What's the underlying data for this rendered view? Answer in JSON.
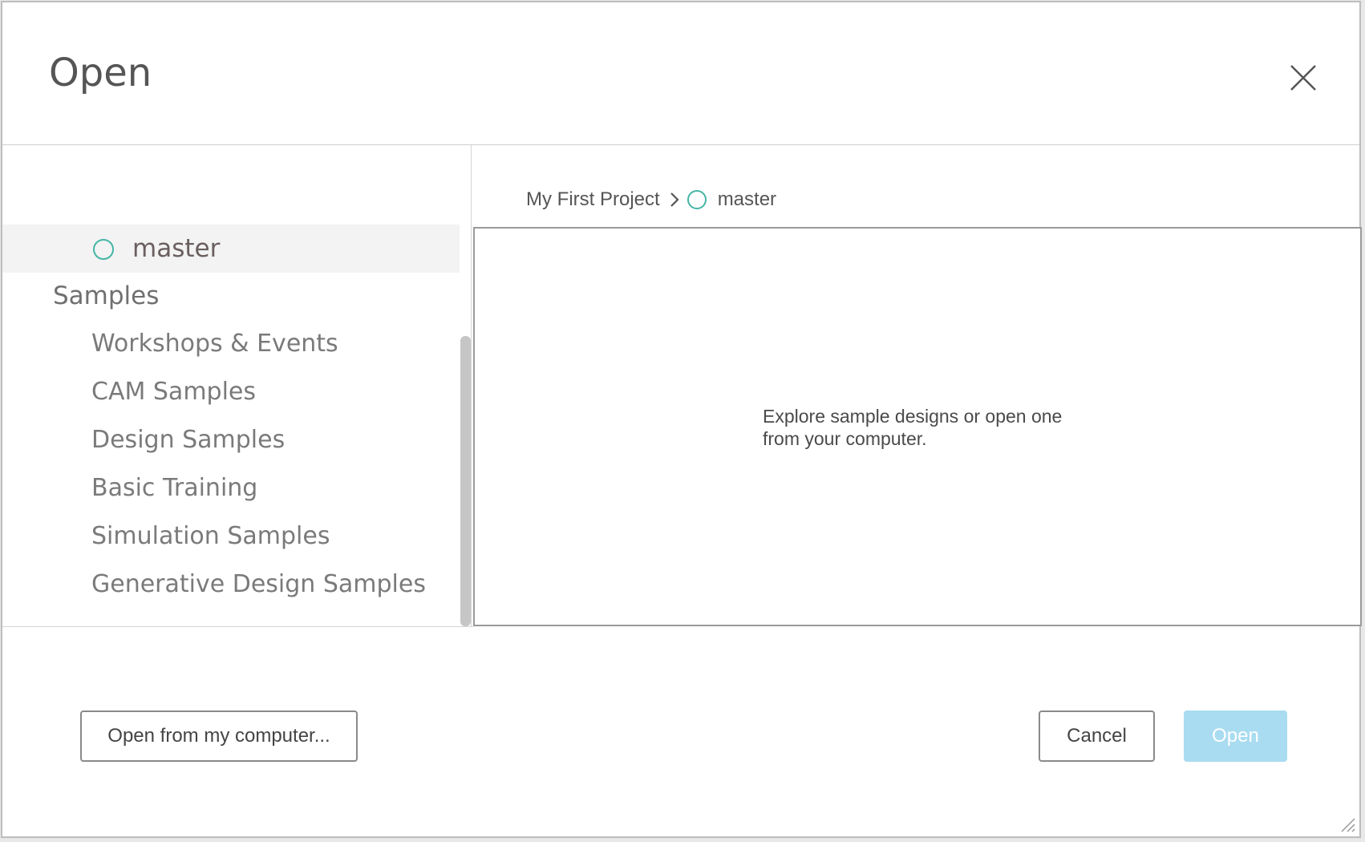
{
  "dialog": {
    "title": "Open"
  },
  "sidebar": {
    "selected_branch": "master",
    "section_label": "Samples",
    "items": [
      {
        "label": "Workshops & Events"
      },
      {
        "label": "CAM Samples"
      },
      {
        "label": "Design Samples"
      },
      {
        "label": "Basic Training"
      },
      {
        "label": "Simulation Samples"
      },
      {
        "label": "Generative Design Samples"
      }
    ]
  },
  "breadcrumb": {
    "project": "My First Project",
    "branch": "master"
  },
  "content": {
    "message_line1": "Explore sample designs or open one",
    "message_line2": "from your computer."
  },
  "footer": {
    "open_from_computer_label": "Open from my computer...",
    "cancel_label": "Cancel",
    "open_label": "Open"
  },
  "colors": {
    "branch_icon": "#45b5a6",
    "open_button_disabled": "#a9dcf0"
  }
}
